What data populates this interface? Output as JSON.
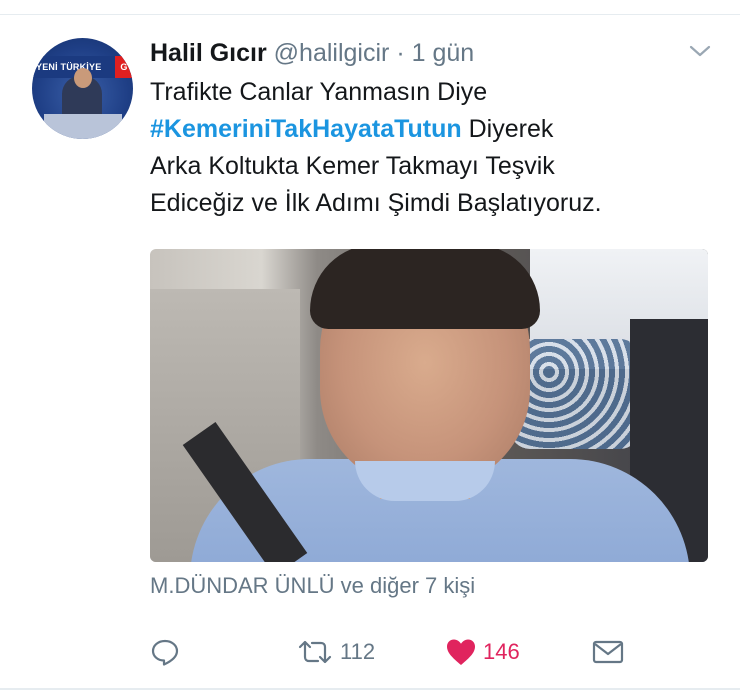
{
  "tweet": {
    "author_name": "Halil Gıcır",
    "handle": "@halilgicir",
    "separator": "·",
    "timestamp": "1 gün",
    "avatar_banner_text": "YENİ TÜRKİYE",
    "avatar_banner_tail": "G",
    "text_line1": "Trafikte Canlar Yanmasın Diye",
    "hashtag": "#KemeriniTakHayataTutun",
    "text_line2_rest": " Diyerek",
    "text_line3": "Arka Koltukta Kemer Takmayı Teşvik",
    "text_line4": "Ediceğiz ve İlk Adımı Şimdi Başlatıyoruz.",
    "liked_by": "M.DÜNDAR ÜNLÜ ve diğer 7 kişi"
  },
  "actions": {
    "reply_icon": "reply-icon",
    "retweet_icon": "retweet-icon",
    "retweet_count": "112",
    "like_icon": "heart-icon",
    "like_count": "146",
    "dm_icon": "envelope-icon"
  },
  "colors": {
    "hashtag": "#1b95e0",
    "muted": "#657786",
    "like": "#e0245e",
    "text": "#14171a"
  }
}
